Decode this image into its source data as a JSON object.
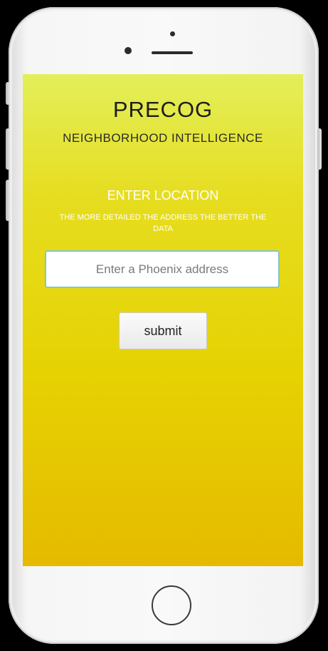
{
  "app": {
    "title": "PRECOG",
    "subtitle": "NEIGHBORHOOD INTELLIGENCE"
  },
  "location": {
    "heading": "ENTER LOCATION",
    "hint": "THE MORE DETAILED THE ADDRESS THE BETTER THE DATA",
    "input_value": "",
    "input_placeholder": "Enter a Phoenix address"
  },
  "actions": {
    "submit_label": "submit"
  },
  "colors": {
    "screen_top": "#e3ef5a",
    "screen_bottom": "#e5ba00",
    "input_border": "#7fc7c9"
  },
  "icons": {
    "home_button": "home-button-icon",
    "front_camera": "camera-icon",
    "earpiece": "speaker-icon"
  }
}
